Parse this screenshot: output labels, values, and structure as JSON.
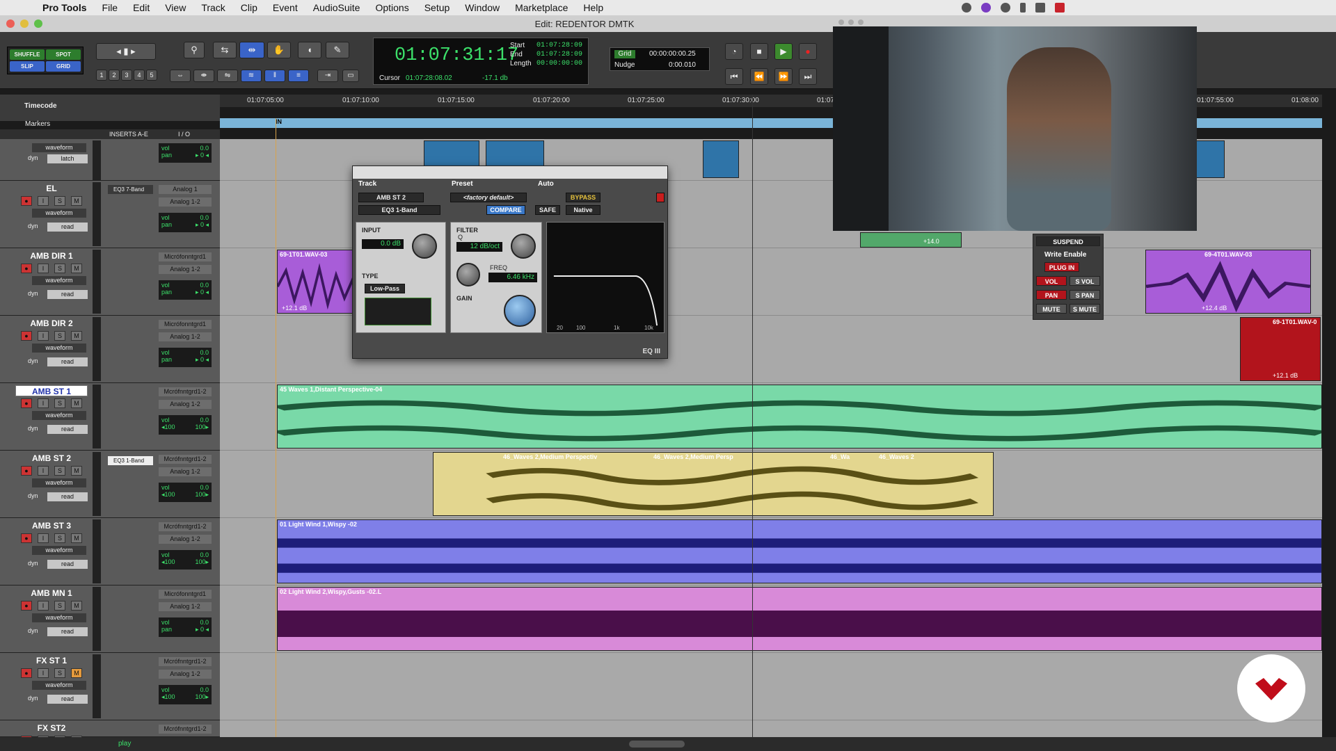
{
  "menubar": {
    "app": "Pro Tools",
    "items": [
      "File",
      "Edit",
      "View",
      "Track",
      "Clip",
      "Event",
      "AudioSuite",
      "Options",
      "Setup",
      "Window",
      "Marketplace",
      "Help"
    ]
  },
  "window": {
    "title": "Edit: REDENTOR DMTK"
  },
  "modes": {
    "shuffle": "SHUFFLE",
    "spot": "SPOT",
    "slip": "SLIP",
    "grid": "GRID"
  },
  "zoom_presets": [
    "1",
    "2",
    "3",
    "4",
    "5"
  ],
  "counter": {
    "main": "01:07:31:17",
    "start_label": "Start",
    "end_label": "End",
    "length_label": "Length",
    "start": "01:07:28:09",
    "end": "01:07:28:09",
    "length": "00:00:00:00",
    "cursor_label": "Cursor",
    "cursor": "01:07:28:08.02",
    "cursor_db": "-17.1 db"
  },
  "gridnudge": {
    "grid_label": "Grid",
    "grid_value": "00:00:00:00.25",
    "nudge_label": "Nudge",
    "nudge_value": "0:00.010"
  },
  "ruler": {
    "label": "Timecode",
    "markers_label": "Markers",
    "in_marker": "IN",
    "ticks": [
      "01:07:05:00",
      "01:07:10:00",
      "01:07:15:00",
      "01:07:20:00",
      "01:07:25:00",
      "01:07:30:00",
      "01:07",
      "01:07:55:00",
      "01:08:00"
    ]
  },
  "columns": {
    "inserts": "INSERTS A-E",
    "io": "I / O"
  },
  "tracks": [
    {
      "name": "",
      "mode": "waveform",
      "dyn": "dyn",
      "auto": "latch",
      "insert": "",
      "io1": "",
      "io2": "",
      "vol": "vol",
      "vol_v": "0.0",
      "pan": "pan",
      "pan_v": "▸ 0 ◂"
    },
    {
      "name": "EL",
      "mode": "waveform",
      "dyn": "dyn",
      "auto": "read",
      "insert": "EQ3 7-Band",
      "io1": "Analog 1",
      "io2": "Analog 1-2",
      "vol": "vol",
      "vol_v": "0.0",
      "pan": "pan",
      "pan_v": "▸ 0 ◂"
    },
    {
      "name": "AMB DIR 1",
      "mode": "waveform",
      "dyn": "dyn",
      "auto": "read",
      "insert": "",
      "io1": "Micrófonntgrd1",
      "io2": "Analog 1-2",
      "vol": "vol",
      "vol_v": "0.0",
      "pan": "pan",
      "pan_v": "▸ 0 ◂"
    },
    {
      "name": "AMB DIR 2",
      "mode": "waveform",
      "dyn": "dyn",
      "auto": "read",
      "insert": "",
      "io1": "Micrófonntgrd1",
      "io2": "Analog 1-2",
      "vol": "vol",
      "vol_v": "0.0",
      "pan": "pan",
      "pan_v": "▸ 0 ◂"
    },
    {
      "name": "AMB ST 1",
      "mode": "waveform",
      "dyn": "dyn",
      "auto": "read",
      "insert": "",
      "io1": "Mcrófnntgrd1-2",
      "io2": "Analog 1-2",
      "vol": "vol",
      "vol_v": "0.0",
      "pan": "◂100",
      "pan_v": "100▸"
    },
    {
      "name": "AMB ST 2",
      "mode": "waveform",
      "dyn": "dyn",
      "auto": "read",
      "insert": "EQ3 1-Band",
      "io1": "Mcrófnntgrd1-2",
      "io2": "Analog 1-2",
      "vol": "vol",
      "vol_v": "0.0",
      "pan": "◂100",
      "pan_v": "100▸"
    },
    {
      "name": "AMB ST 3",
      "mode": "waveform",
      "dyn": "dyn",
      "auto": "read",
      "insert": "",
      "io1": "Mcrófnntgrd1-2",
      "io2": "Analog 1-2",
      "vol": "vol",
      "vol_v": "0.0",
      "pan": "◂100",
      "pan_v": "100▸"
    },
    {
      "name": "AMB MN 1",
      "mode": "waveform",
      "dyn": "dyn",
      "auto": "read",
      "insert": "",
      "io1": "Micrófonntgrd1",
      "io2": "Analog 1-2",
      "vol": "vol",
      "vol_v": "0.0",
      "pan": "pan",
      "pan_v": "▸ 0 ◂"
    },
    {
      "name": "FX ST 1",
      "mode": "waveform",
      "dyn": "dyn",
      "auto": "read",
      "insert": "",
      "io1": "Mcrófnntgrd1-2",
      "io2": "Analog 1-2",
      "vol": "vol",
      "vol_v": "0.0",
      "pan": "◂100",
      "pan_v": "100▸"
    },
    {
      "name": "FX ST2",
      "mode": "",
      "dyn": "",
      "auto": "",
      "insert": "",
      "io1": "Mcrófnntgrd1-2",
      "io2": "",
      "vol": "",
      "vol_v": "",
      "pan": "",
      "pan_v": ""
    }
  ],
  "clips": {
    "amb_dir1": {
      "name": "69-1T01.WAV-03",
      "gain": "+12.1 dB"
    },
    "amb_dir1_b": {
      "name": "69-4T01.WAV-03",
      "gain": "+12.4 dB"
    },
    "amb_dir2": {
      "name": "69-1T01.WAV-0",
      "gain": "+12.1 dB"
    },
    "amb_st1": {
      "name": "45 Waves 1,Distant Perspective-04"
    },
    "amb_st2_a": {
      "name": "46_Waves 2,Medium Perspectiv"
    },
    "amb_st2_b": {
      "name": "46_Waves 2,Medium Persp"
    },
    "amb_st2_c": {
      "name": "46_Wa"
    },
    "amb_st2_d": {
      "name": "46_Waves 2"
    },
    "amb_st3": {
      "name": "01 Light Wind 1,Wispy -02"
    },
    "amb_mn1": {
      "name": "02 Light Wind 2,Wispy,Gusts -02.L"
    },
    "el_gain": "+14.0"
  },
  "plugin": {
    "track_label": "Track",
    "preset_label": "Preset",
    "auto_label": "Auto",
    "track_name": "AMB ST 2",
    "plugin_name": "EQ3 1-Band",
    "preset": "<factory default>",
    "compare": "COMPARE",
    "bypass": "BYPASS",
    "safe": "SAFE",
    "native": "Native",
    "input_label": "INPUT",
    "input_val": "0.0 dB",
    "filter_label": "FILTER",
    "q_label": "Q",
    "slope": "12 dB/oct",
    "freq_label": "FREQ",
    "freq_val": "6.46 kHz",
    "type_label": "TYPE",
    "type_val": "Low-Pass",
    "gain_label": "GAIN",
    "axis": [
      "20",
      "100",
      "1k",
      "10k"
    ],
    "logo": "EQ III"
  },
  "autowin": {
    "suspend": "SUSPEND",
    "write_enable": "Write Enable",
    "plugin": "PLUG IN",
    "vol": "VOL",
    "svol": "S VOL",
    "pan": "PAN",
    "span": "S PAN",
    "mute": "MUTE",
    "smute": "S MUTE"
  },
  "status": {
    "play": "play"
  },
  "colors": {
    "green": "#3ce06a",
    "amb_st1": "#79d9a8",
    "amb_st2": "#e3d68f",
    "amb_st3": "#7f7fe8",
    "amb_mn1": "#d88ad8",
    "dir": "#a85dd8",
    "red": "#b2141c"
  }
}
